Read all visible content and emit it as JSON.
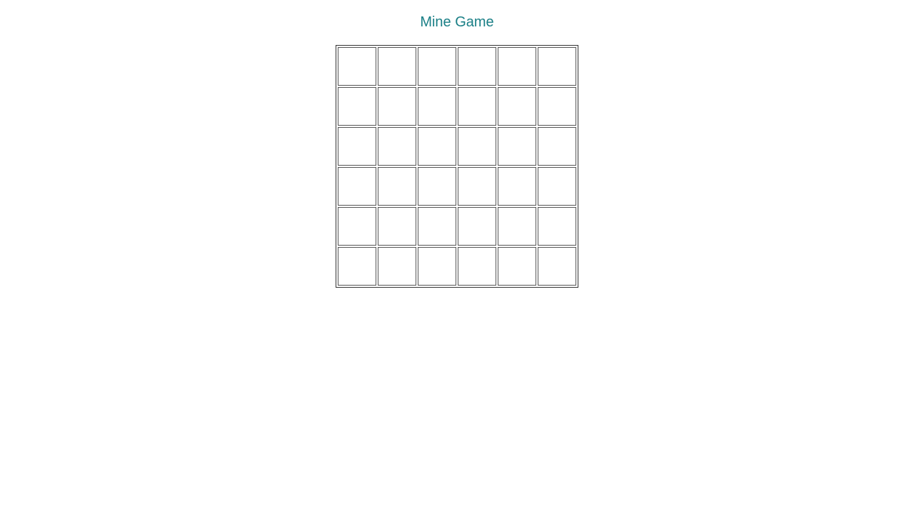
{
  "header": {
    "title": "Mine Game"
  },
  "board": {
    "rows": 6,
    "cols": 6,
    "cells": [
      [
        "",
        "",
        "",
        "",
        "",
        ""
      ],
      [
        "",
        "",
        "",
        "",
        "",
        ""
      ],
      [
        "",
        "",
        "",
        "",
        "",
        ""
      ],
      [
        "",
        "",
        "",
        "",
        "",
        ""
      ],
      [
        "",
        "",
        "",
        "",
        "",
        ""
      ],
      [
        "",
        "",
        "",
        "",
        "",
        ""
      ]
    ]
  },
  "colors": {
    "title": "#1a7f86",
    "cell_border": "#555555",
    "table_border": "#333333",
    "background": "#ffffff"
  }
}
